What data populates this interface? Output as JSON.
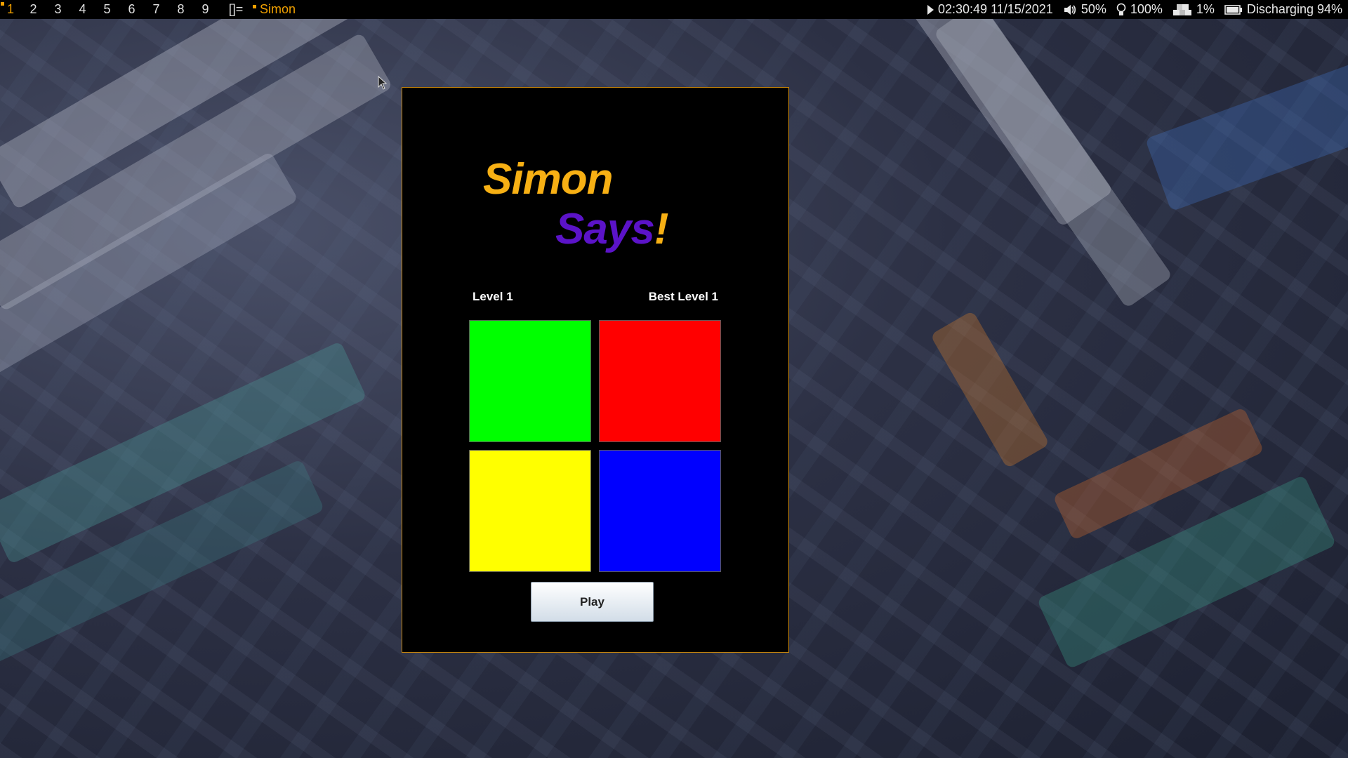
{
  "topbar": {
    "workspaces": [
      "1",
      "2",
      "3",
      "4",
      "5",
      "6",
      "7",
      "8",
      "9"
    ],
    "active_workspace": "1",
    "layout_symbol": "[]=",
    "window_title": "Simon",
    "datetime": "02:30:49 11/15/2021",
    "volume": "50%",
    "brightness": "100%",
    "cpu": "1%",
    "battery": "Discharging 94%",
    "accent_color": "#f0a000"
  },
  "simon": {
    "title_line1": "Simon",
    "title_line2": "Says",
    "title_exclamation": "!",
    "level_label": "Level 1",
    "best_level_label": "Best Level 1",
    "pads": [
      {
        "name": "green",
        "color": "#00ff00"
      },
      {
        "name": "red",
        "color": "#ff0000"
      },
      {
        "name": "yellow",
        "color": "#ffff00"
      },
      {
        "name": "blue",
        "color": "#0000ff"
      }
    ],
    "play_label": "Play",
    "title_color_1": "#f7b014",
    "title_color_2": "#5b13c8"
  }
}
